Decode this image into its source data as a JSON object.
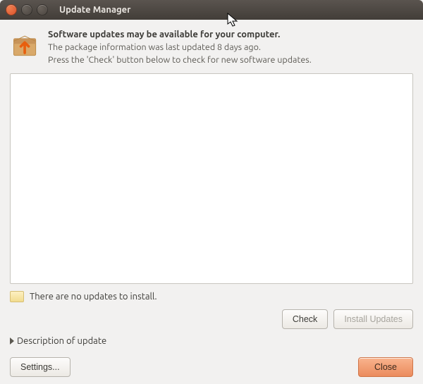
{
  "window": {
    "title": "Update Manager"
  },
  "header": {
    "title": "Software updates may be available for your computer.",
    "line1": "The package information was last updated 8 days ago.",
    "line2": "Press the 'Check' button below to check for new software updates."
  },
  "status": {
    "text": "There are no updates to install."
  },
  "buttons": {
    "check": "Check",
    "install": "Install Updates",
    "settings": "Settings...",
    "close": "Close"
  },
  "expander": {
    "label": "Description of update"
  },
  "colors": {
    "accent": "#eb8b5d"
  }
}
